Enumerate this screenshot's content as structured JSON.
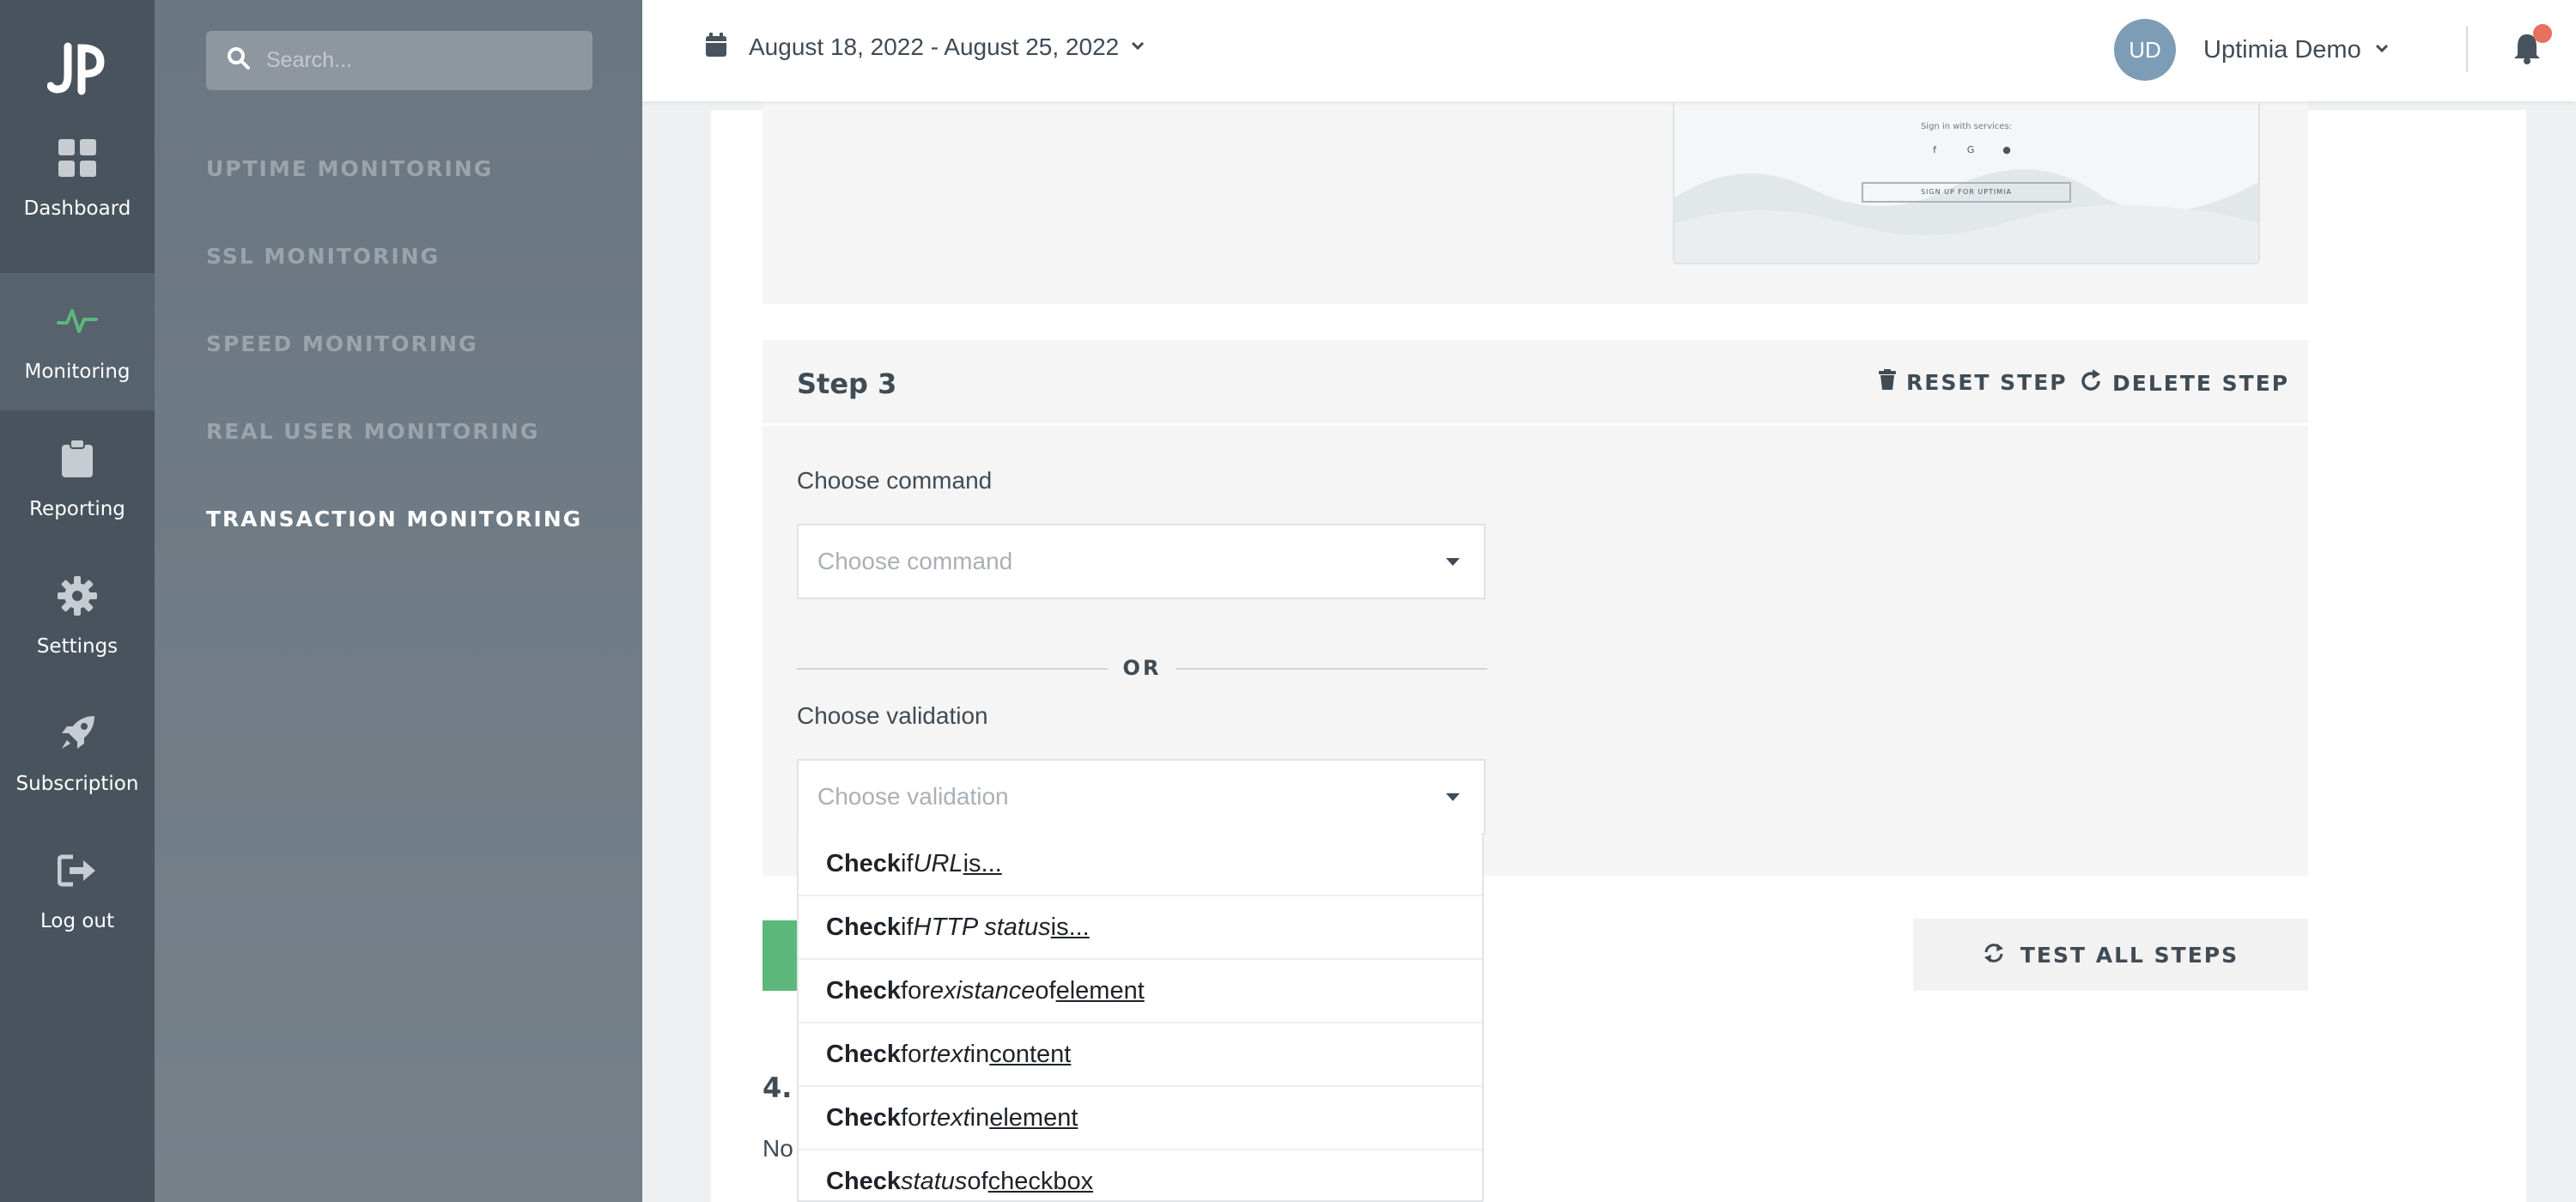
{
  "rail": {
    "items": [
      {
        "label": "Dashboard",
        "icon": "dashboard-icon"
      },
      {
        "label": "Monitoring",
        "icon": "pulse-icon"
      },
      {
        "label": "Reporting",
        "icon": "clipboard-icon"
      },
      {
        "label": "Settings",
        "icon": "gear-icon"
      },
      {
        "label": "Subscription",
        "icon": "rocket-icon"
      },
      {
        "label": "Log out",
        "icon": "logout-icon"
      }
    ],
    "active": "Monitoring"
  },
  "subnav": {
    "search_placeholder": "Search...",
    "items": [
      {
        "label": "UPTIME MONITORING"
      },
      {
        "label": "SSL MONITORING"
      },
      {
        "label": "SPEED MONITORING"
      },
      {
        "label": "REAL USER MONITORING"
      },
      {
        "label": "TRANSACTION MONITORING"
      }
    ],
    "active": "TRANSACTION MONITORING"
  },
  "topbar": {
    "date_range": "August 18, 2022 - August 25, 2022",
    "user_initials": "UD",
    "user_name": "Uptimia Demo"
  },
  "thumbnail": {
    "signin_text": "Sign in with services:",
    "signup_text": "SIGN UP FOR UPTIMIA",
    "social_icons": [
      "facebook-icon",
      "google-icon",
      "github-icon"
    ]
  },
  "step3": {
    "title": "Step 3",
    "reset_label": "RESET STEP",
    "delete_label": "DELETE STEP",
    "command_label": "Choose command",
    "command_placeholder": "Choose command",
    "or_label": "OR",
    "validation_label": "Choose validation",
    "validation_placeholder": "Choose validation"
  },
  "dropdown": {
    "options": [
      {
        "verb": "Check",
        "a": "if",
        "b": "URL",
        "c": "",
        "d": "is..."
      },
      {
        "verb": "Check",
        "a": "if",
        "b": "HTTP status",
        "c": "",
        "d": "is..."
      },
      {
        "verb": "Check",
        "a": "for",
        "b": "existance",
        "c": "of",
        "d": "element"
      },
      {
        "verb": "Check",
        "a": "for",
        "b": "text",
        "c": "in",
        "d": "content"
      },
      {
        "verb": "Check",
        "a": "for",
        "b": "text",
        "c": "in",
        "d": "element"
      },
      {
        "verb": "Check",
        "a": "",
        "b": "status",
        "c": "of",
        "d": "checkbox"
      }
    ]
  },
  "actions": {
    "test_all_label": "TEST ALL STEPS"
  },
  "step4": {
    "number": "4.",
    "text_partial": "No"
  },
  "colors": {
    "rail_bg": "#48535d",
    "subnav_bg": "#6a7680",
    "accent_green": "#5cb87a",
    "notification_dot": "#e8705f",
    "avatar_bg": "#7d9cb5"
  }
}
